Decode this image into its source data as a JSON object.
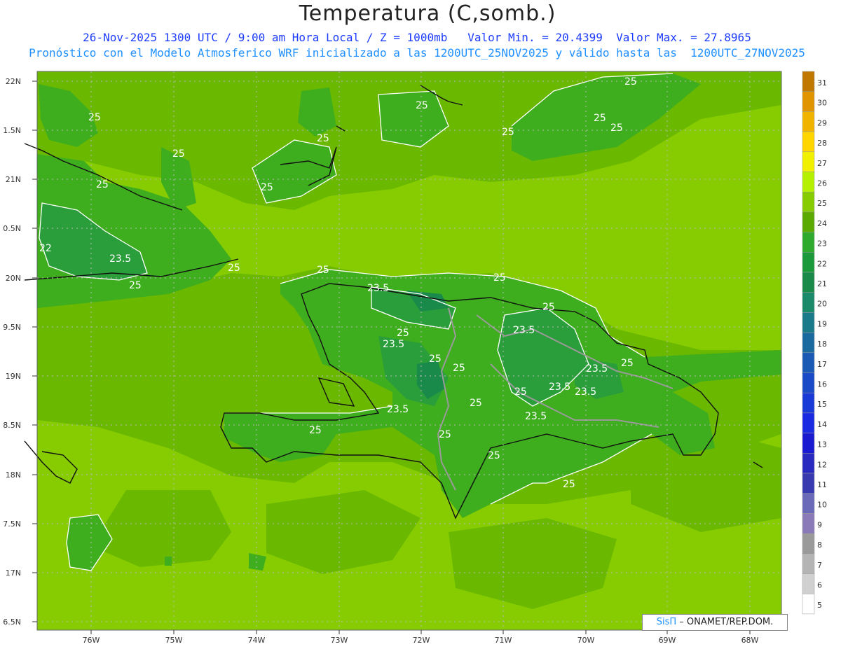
{
  "header": {
    "title": "Temperatura (C,somb.)",
    "line1": "26-Nov-2025 1300 UTC / 9:00 am Hora Local / Z = 1000mb   Valor Min. = 20.4399  Valor Max. = 27.8965",
    "line2": "Pronóstico con el Modelo Atmosferico WRF inicializado a las 1200UTC_25NOV2025 y válido hasta las  1200UTC_27NOV2025"
  },
  "axes": {
    "lat_labels": [
      "22N",
      "1.5N",
      "21N",
      "0.5N",
      "20N",
      "9.5N",
      "19N",
      "8.5N",
      "18N",
      "7.5N",
      "17N",
      "6.5N"
    ],
    "lon_labels": [
      "76W",
      "75W",
      "74W",
      "73W",
      "72W",
      "71W",
      "70W",
      "69W",
      "68W"
    ]
  },
  "colorbar": {
    "labels": [
      "31",
      "30",
      "29",
      "28",
      "27",
      "26",
      "25",
      "24",
      "23",
      "22",
      "21",
      "20",
      "19",
      "18",
      "17",
      "16",
      "15",
      "14",
      "13",
      "12",
      "11",
      "10",
      "9",
      "8",
      "7",
      "6",
      "5"
    ],
    "colors": [
      "#c07800",
      "#e09400",
      "#f0b400",
      "#ffd600",
      "#f0f000",
      "#b4f000",
      "#86cc00",
      "#5aaa00",
      "#2eaa2e",
      "#1a9a3a",
      "#1a8a4a",
      "#1a8a6a",
      "#1a7a8a",
      "#1a6aa0",
      "#1a5ab4",
      "#1a4ac8",
      "#1a3ad8",
      "#1a2ae0",
      "#1a1ad0",
      "#2a2ac0",
      "#3a3ab0",
      "#6a6ab8",
      "#8a7ab8",
      "#9a9a9a",
      "#b4b4b4",
      "#d0d0d0",
      "#ffffff"
    ]
  },
  "contour_labels": [
    "25",
    "25",
    "25",
    "25",
    "25",
    "25",
    "25",
    "25",
    "25",
    "25",
    "23.5",
    "23.5",
    "22",
    "25",
    "25",
    "23.5",
    "25",
    "23.5",
    "25",
    "25",
    "25",
    "23.5",
    "25",
    "23.5",
    "25",
    "25",
    "25",
    "23.5",
    "25",
    "23.5",
    "23.5",
    "25",
    "25",
    "25"
  ],
  "colors": {
    "field_base": "#86cc00",
    "field_mid": "#6ab800",
    "field_warm": "#5aaa00",
    "field_cool": "#2eaa2e",
    "field_cooler": "#1a9a3a",
    "coast": "#111111",
    "border": "#9a9a9a",
    "contour": "#ffffff"
  },
  "credit": {
    "logo": "SisΠ",
    "text": " – ONAMET/REP.DOM."
  }
}
